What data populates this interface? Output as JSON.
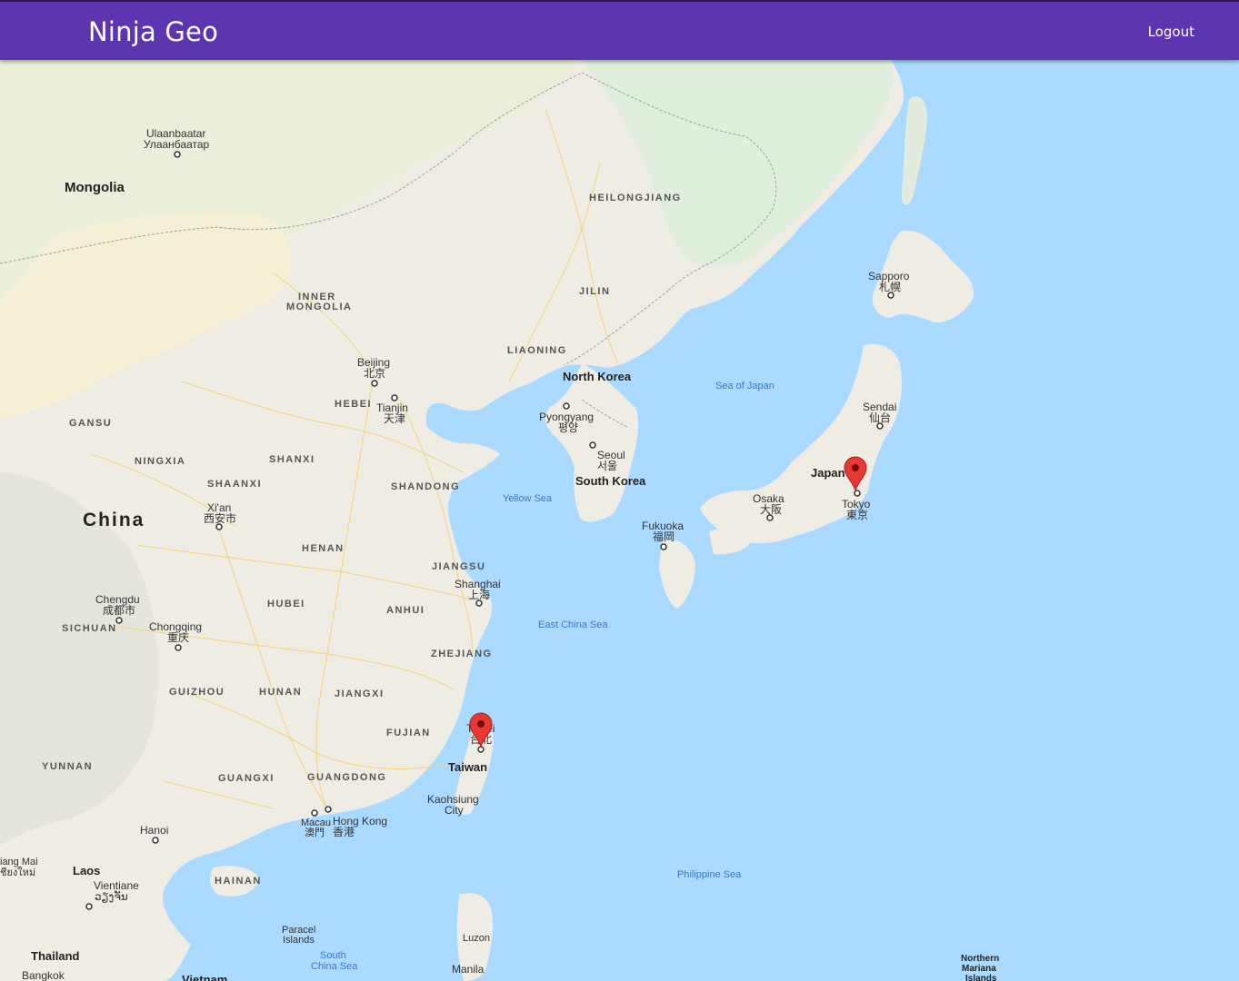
{
  "header": {
    "title": "Ninja Geo",
    "logout_label": "Logout"
  },
  "map": {
    "countries": [
      {
        "id": "mongolia",
        "label": "Mongolia"
      },
      {
        "id": "china",
        "label": "China"
      },
      {
        "id": "north-korea",
        "label": "North Korea"
      },
      {
        "id": "south-korea",
        "label": "South Korea"
      },
      {
        "id": "japan",
        "label": "Japan"
      },
      {
        "id": "taiwan",
        "label": "Taiwan"
      },
      {
        "id": "laos",
        "label": "Laos"
      },
      {
        "id": "thailand",
        "label": "Thailand"
      },
      {
        "id": "vietnam",
        "label": "Vietnam"
      }
    ],
    "regions": [
      "HEILONGJIANG",
      "JILIN",
      "LIAONING",
      "INNER",
      "MONGOLIA",
      "HEBEI",
      "GANSU",
      "NINGXIA",
      "SHANXI",
      "SHAANXI",
      "SHANDONG",
      "HENAN",
      "JIANGSU",
      "HUBEI",
      "ANHUI",
      "SICHUAN",
      "ZHEJIANG",
      "GUIZHOU",
      "HUNAN",
      "JIANGXI",
      "FUJIAN",
      "YUNNAN",
      "GUANGXI",
      "GUANGDONG",
      "HAINAN"
    ],
    "cities": {
      "ulaanbaatar": [
        "Ulaanbaatar",
        "Улаанбаатар"
      ],
      "beijing": [
        "Beijing",
        "北京"
      ],
      "tianjin": [
        "Tianjin",
        "天津"
      ],
      "pyongyang": [
        "Pyongyang",
        "평양"
      ],
      "seoul": [
        "Seoul",
        "서울"
      ],
      "sapporo": [
        "Sapporo",
        "札幌"
      ],
      "sendai": [
        "Sendai",
        "仙台"
      ],
      "tokyo": [
        "Tokyo",
        "東京"
      ],
      "osaka": [
        "Osaka",
        "大阪"
      ],
      "fukuoka": [
        "Fukuoka",
        "福岡"
      ],
      "xian": [
        "Xi'an",
        "西安市"
      ],
      "shanghai": [
        "Shanghai",
        "上海"
      ],
      "chengdu": [
        "Chengdu",
        "成都市"
      ],
      "chongqing": [
        "Chongqing",
        "重庆"
      ],
      "taipei": [
        "Taipei",
        "台北"
      ],
      "kaohsiung": [
        "Kaohsiung",
        "City"
      ],
      "macau": [
        "Macau",
        "澳門"
      ],
      "hongkong": [
        "Hong Kong",
        "香港"
      ],
      "hanoi": [
        "Hanoi"
      ],
      "vientiane": [
        "Vientiane",
        "ວຽງຈັນ"
      ],
      "chiangmai": [
        "iang Mai",
        "ชียงใหม่"
      ],
      "bangkok": [
        "Bangkok"
      ],
      "manila": [
        "Manila"
      ],
      "luzon": [
        "Luzon"
      ]
    },
    "seas": [
      "Sea of Japan",
      "Yellow Sea",
      "East China Sea",
      "Philippine Sea",
      "South",
      "China Sea",
      "Paracel",
      "Islands",
      "Northern",
      "Mariana",
      "Islands"
    ],
    "markers": [
      {
        "id": "tokyo-marker",
        "color": "#e53935"
      },
      {
        "id": "taipei-marker",
        "color": "#e53935"
      }
    ],
    "colors": {
      "land": "#efece4",
      "sea": "#aadaff",
      "road": "#f7d77b",
      "green": "#cfe5c4",
      "desert": "#f4efd5"
    }
  }
}
